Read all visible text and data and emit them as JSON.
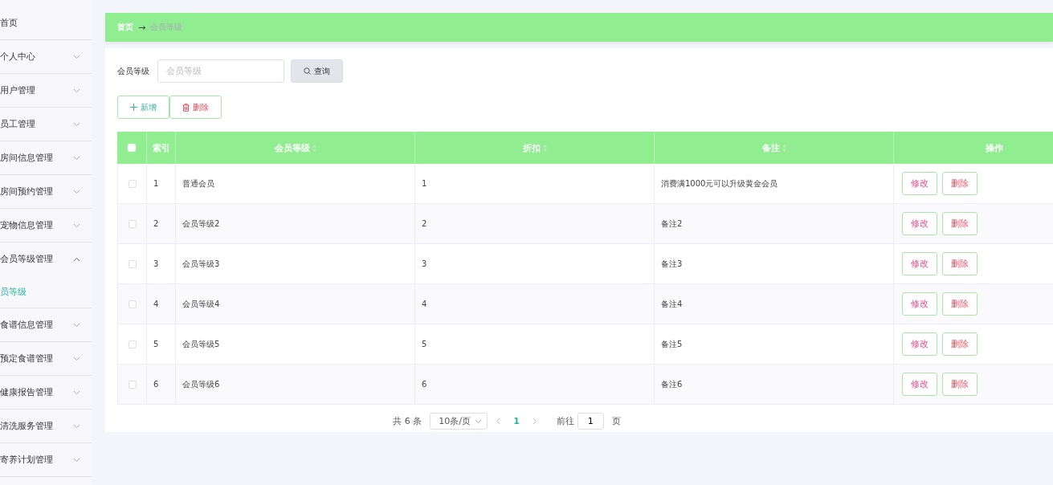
{
  "sidebar": {
    "items": [
      {
        "label": "首页"
      },
      {
        "label": "个人中心",
        "expanded": false
      },
      {
        "label": "用户管理",
        "expanded": false
      },
      {
        "label": "员工管理",
        "expanded": false
      },
      {
        "label": "房间信息管理",
        "expanded": false
      },
      {
        "label": "房间预约管理",
        "expanded": false
      },
      {
        "label": "宠物信息管理",
        "expanded": false
      },
      {
        "label": "会员等级管理",
        "expanded": true,
        "children": [
          {
            "label": "员等级",
            "selected": true
          }
        ]
      },
      {
        "label": "食谱信息管理",
        "expanded": false
      },
      {
        "label": "预定食谱管理",
        "expanded": false
      },
      {
        "label": "健康报告管理",
        "expanded": false
      },
      {
        "label": "清洗服务管理",
        "expanded": false
      },
      {
        "label": "寄养计划管理",
        "expanded": false
      }
    ]
  },
  "breadcrumb": {
    "home": "首页",
    "separator": "→",
    "current": "会员等级"
  },
  "search": {
    "label": "会员等级",
    "placeholder": "会员等级",
    "button": "查询"
  },
  "actions": {
    "add": "新增",
    "delete": "删除"
  },
  "table": {
    "all_checked": false,
    "columns": [
      {
        "label": "索引",
        "sortable": false
      },
      {
        "label": "会员等级",
        "sortable": true
      },
      {
        "label": "折扣",
        "sortable": true
      },
      {
        "label": "备注",
        "sortable": true
      },
      {
        "label": "操作",
        "sortable": false
      }
    ],
    "rows": [
      {
        "checked": false,
        "index": "1",
        "level": "普通会员",
        "discount": "1",
        "note": "消费满1000元可以升级黄金会员",
        "edit": "修改",
        "delete": "删除"
      },
      {
        "checked": false,
        "index": "2",
        "level": "会员等级2",
        "discount": "2",
        "note": "备注2",
        "edit": "修改",
        "delete": "删除"
      },
      {
        "checked": false,
        "index": "3",
        "level": "会员等级3",
        "discount": "3",
        "note": "备注3",
        "edit": "修改",
        "delete": "删除"
      },
      {
        "checked": false,
        "index": "4",
        "level": "会员等级4",
        "discount": "4",
        "note": "备注4",
        "edit": "修改",
        "delete": "删除"
      },
      {
        "checked": false,
        "index": "5",
        "level": "会员等级5",
        "discount": "5",
        "note": "备注5",
        "edit": "修改",
        "delete": "删除"
      },
      {
        "checked": false,
        "index": "6",
        "level": "会员等级6",
        "discount": "6",
        "note": "备注6",
        "edit": "修改",
        "delete": "删除"
      }
    ]
  },
  "pagination": {
    "total": "共 6 条",
    "page_size": "10条/页",
    "pages": [
      {
        "label": "1",
        "selected": true
      }
    ],
    "goto_label": "前往",
    "goto_value": "1",
    "goto_suffix": "页"
  }
}
